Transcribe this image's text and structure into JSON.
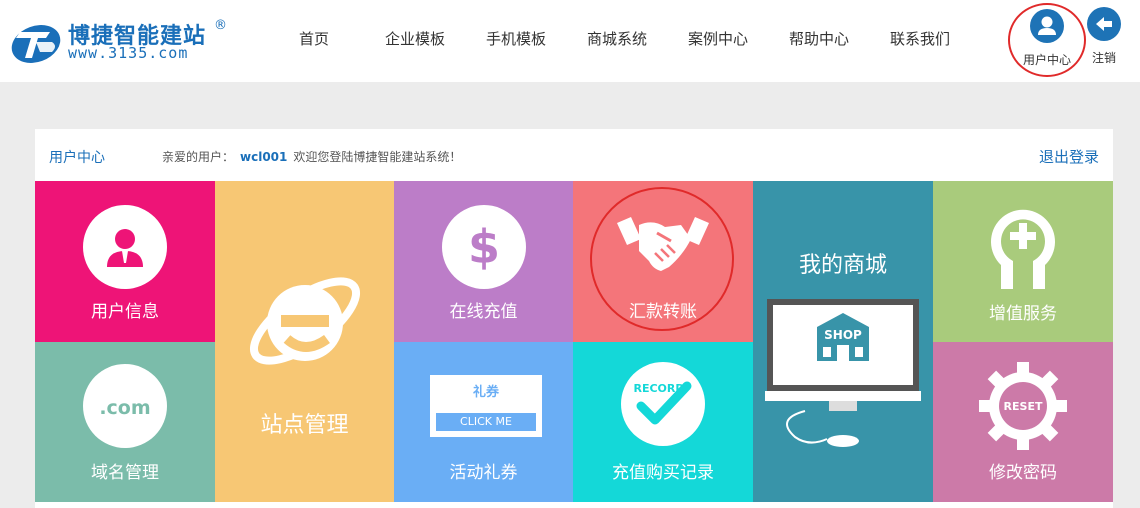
{
  "brand": {
    "name": "博捷智能建站",
    "reg": "®",
    "url": "www.3135.com"
  },
  "nav": {
    "items": [
      "首页",
      "企业模板",
      "手机模板",
      "商城系统",
      "案例中心",
      "帮助中心",
      "联系我们"
    ]
  },
  "header_actions": {
    "user_center": "用户中心",
    "logout": "注销"
  },
  "panel": {
    "title": "用户中心",
    "greeting_prefix": "亲爱的用户：",
    "username": "wcl001",
    "greeting_suffix": "欢迎您登陆博捷智能建站系统！",
    "exit": "退出登录"
  },
  "tiles": {
    "user_info": {
      "label": "用户信息",
      "color": "#ee1477"
    },
    "site_manage": {
      "label": "站点管理",
      "color": "#f7c774"
    },
    "recharge": {
      "label": "在线充值",
      "color": "#bc7dc8"
    },
    "transfer": {
      "label": "汇款转账",
      "color": "#f4757a"
    },
    "shop": {
      "label": "我的商城",
      "icon_text": "SHOP",
      "color": "#3894a9"
    },
    "vas": {
      "label": "增值服务",
      "color": "#a9cb7c"
    },
    "domain": {
      "label": "域名管理",
      "icon_text": ".com",
      "color": "#7bbcaa"
    },
    "coupon": {
      "label": "活动礼券",
      "card_title": "礼券",
      "card_button": "CLICK ME",
      "color": "#6aaef5"
    },
    "records": {
      "label": "充值购买记录",
      "icon_text": "RECORD",
      "color": "#14d8d8"
    },
    "password": {
      "label": "修改密码",
      "icon_text": "RESET",
      "color": "#cc7aa8"
    }
  },
  "colors": {
    "brand_blue": "#1a6fb9",
    "highlight_ring": "#e02a2a"
  }
}
